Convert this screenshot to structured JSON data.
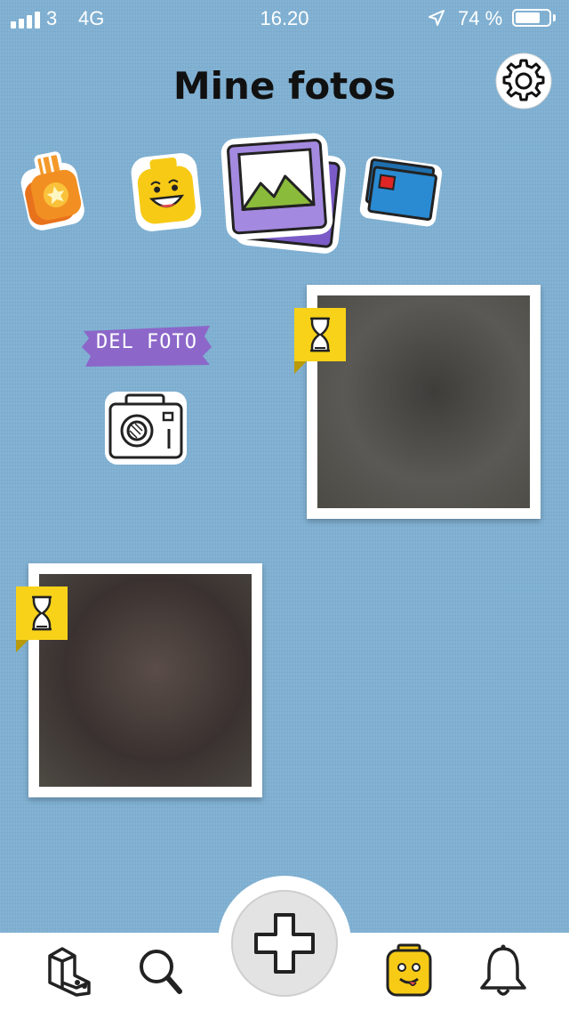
{
  "status_bar": {
    "carrier": "3",
    "network": "4G",
    "time": "16.20",
    "battery_text": "74 %",
    "battery_level": 0.74
  },
  "header": {
    "title": "Mine fotos",
    "settings_icon": "gear-icon"
  },
  "categories": [
    {
      "icon": "badge-icon",
      "selected": false
    },
    {
      "icon": "minifig-head-icon",
      "selected": false
    },
    {
      "icon": "photos-icon",
      "selected": true
    },
    {
      "icon": "cards-icon",
      "selected": false
    }
  ],
  "share": {
    "label": "DEL FOTO",
    "icon": "camera-icon",
    "banner_color": "#8c67c9"
  },
  "photos": [
    {
      "status_icon": "hourglass-icon",
      "colors": [
        "#5a5955",
        "#3f3d3a",
        "#4b4a44"
      ]
    },
    {
      "status_icon": "hourglass-icon",
      "colors": [
        "#3a3230",
        "#5a4d48",
        "#4e4a44"
      ]
    }
  ],
  "nav": {
    "items": [
      {
        "icon": "brick-icon"
      },
      {
        "icon": "search-icon"
      },
      {
        "icon": "plus-icon"
      },
      {
        "icon": "minifig-face-icon"
      },
      {
        "icon": "bell-icon"
      }
    ]
  },
  "colors": {
    "background": "#7fb0d2",
    "accent_yellow": "#f7d218",
    "accent_purple": "#8c67c9"
  }
}
